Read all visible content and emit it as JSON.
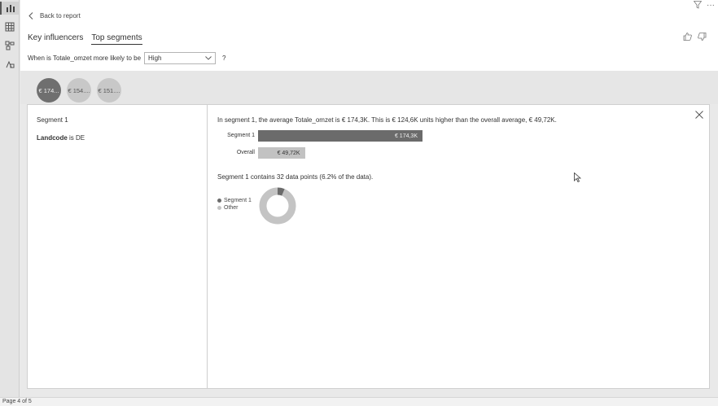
{
  "header": {
    "back_label": "Back to report",
    "tabs": [
      {
        "label": "Key influencers",
        "selected": false
      },
      {
        "label": "Top segments",
        "selected": true
      }
    ]
  },
  "question": {
    "prefix": "When is Totale_omzet more likely to be",
    "selected_value": "High",
    "suffix": "?"
  },
  "segments": [
    {
      "label": "€ 174...",
      "active": true
    },
    {
      "label": "€ 154....",
      "active": false
    },
    {
      "label": "€ 151....",
      "active": false
    }
  ],
  "left_pane": {
    "segment_title": "Segment 1",
    "condition_field": "Landcode",
    "condition_op": "is",
    "condition_value": "DE"
  },
  "detail": {
    "summary": "In segment 1, the average Totale_omzet is € 174,3K. This is € 124,6K units higher than the overall average, € 49,72K.",
    "bars": [
      {
        "label": "Segment 1",
        "value_text": "€ 174,3K",
        "value": 174.3
      },
      {
        "label": "Overall",
        "value_text": "€ 49,72K",
        "value": 49.72
      }
    ],
    "contains": "Segment 1 contains 32 data points (6.2% of the data).",
    "donut": {
      "segment_share": 0.062,
      "legend": [
        {
          "label": "Segment 1",
          "color": "#6b6b6b"
        },
        {
          "label": "Other",
          "color": "#c4c4c4"
        }
      ]
    }
  },
  "status_bar": {
    "page": "Page 4 of 5"
  },
  "colors": {
    "dark": "#6b6b6b",
    "light": "#c4c4c4"
  }
}
